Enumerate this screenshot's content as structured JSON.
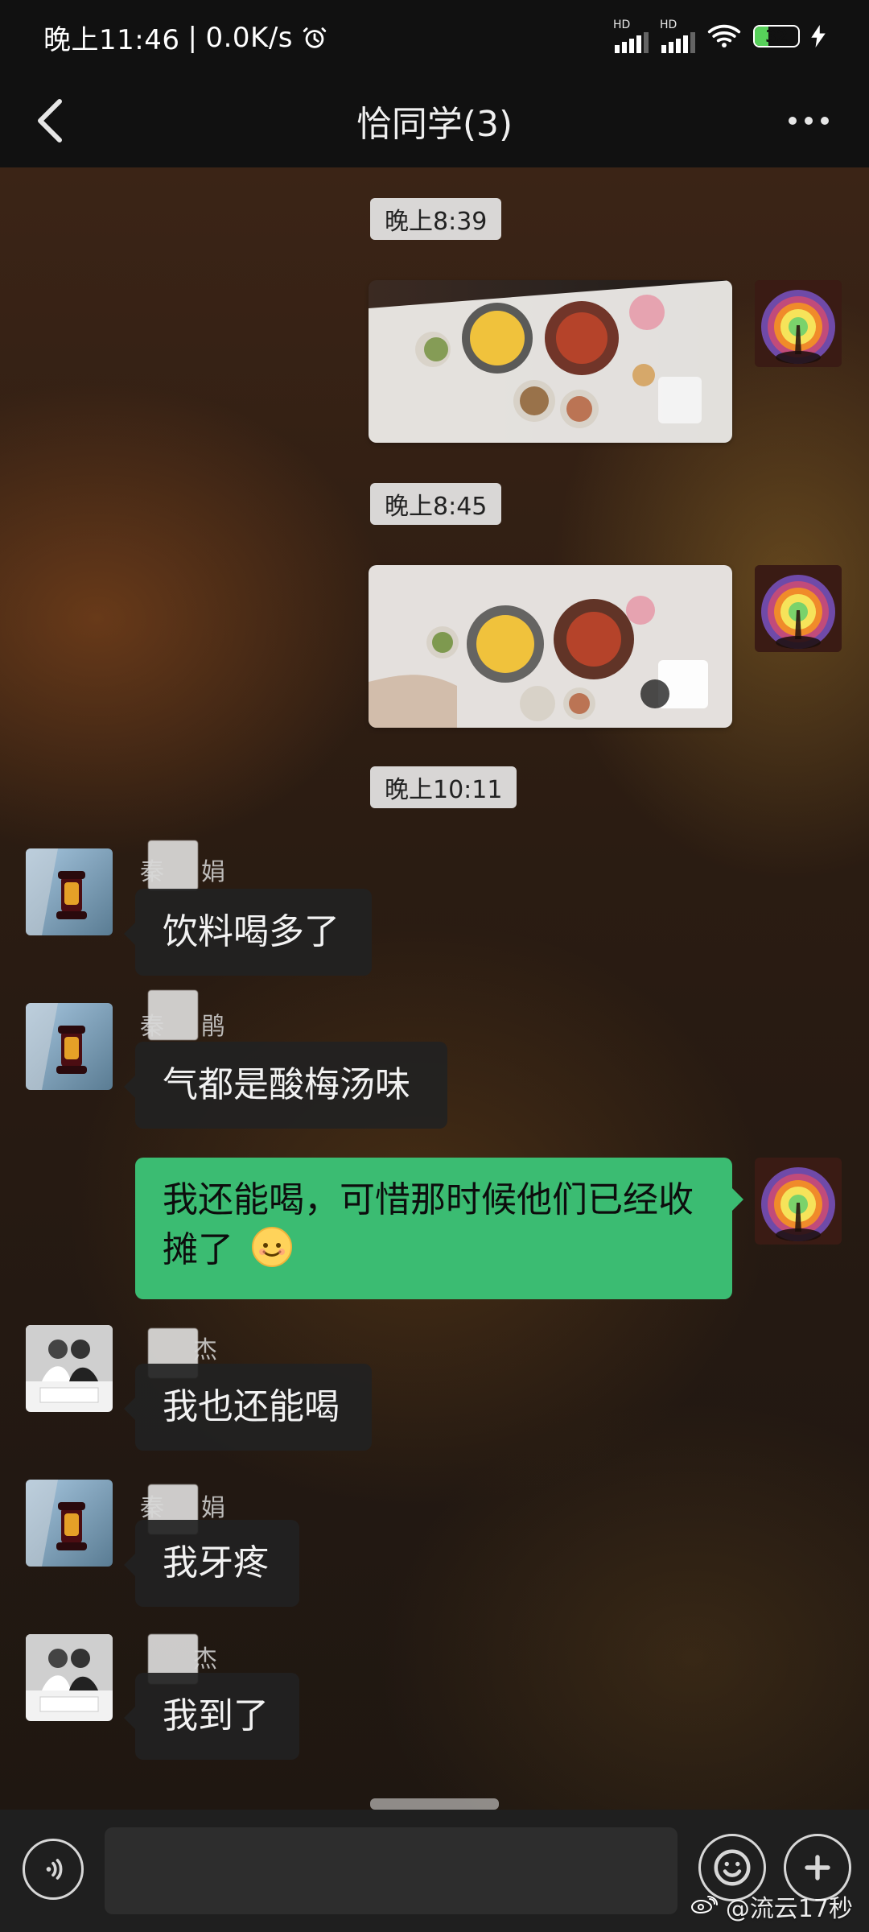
{
  "status_bar": {
    "time": "晚上11:46",
    "network_speed": "0.0K/s",
    "battery_level": "32",
    "battery_percent": 32,
    "icons": [
      "alarm-icon",
      "signal-hd-1-icon",
      "signal-hd-2-icon",
      "wifi-icon",
      "battery-icon",
      "charging-icon"
    ]
  },
  "header": {
    "title": "恰同学(3)",
    "back_icon": "chevron-left-icon",
    "more_icon": "more-dots-icon"
  },
  "messages": {
    "t1": "晚上8:39",
    "t2": "晚上8:45",
    "t3": "晚上10:11",
    "m1": "饮料喝多了",
    "m2": "气都是酸梅汤味",
    "m3": "我还能喝，可惜那时候他们已经收摊了",
    "m4": "我也还能喝",
    "m5": "我牙疼",
    "m6": "我到了",
    "sender_fragments": {
      "s1": "秦",
      "s1_end": "娟",
      "s2": "秦",
      "s2_end": "鹃",
      "s3": "杰",
      "s4": "秦",
      "s4_end": "娟",
      "s5": "杰"
    }
  },
  "input": {
    "placeholder": ""
  },
  "watermark": {
    "text": "@流云17秒"
  },
  "colors": {
    "chat_bg": "#2a1c13",
    "bubble_left": "#222222",
    "bubble_right": "#3bbc72",
    "time_chip_bg": "#ebebeb"
  }
}
